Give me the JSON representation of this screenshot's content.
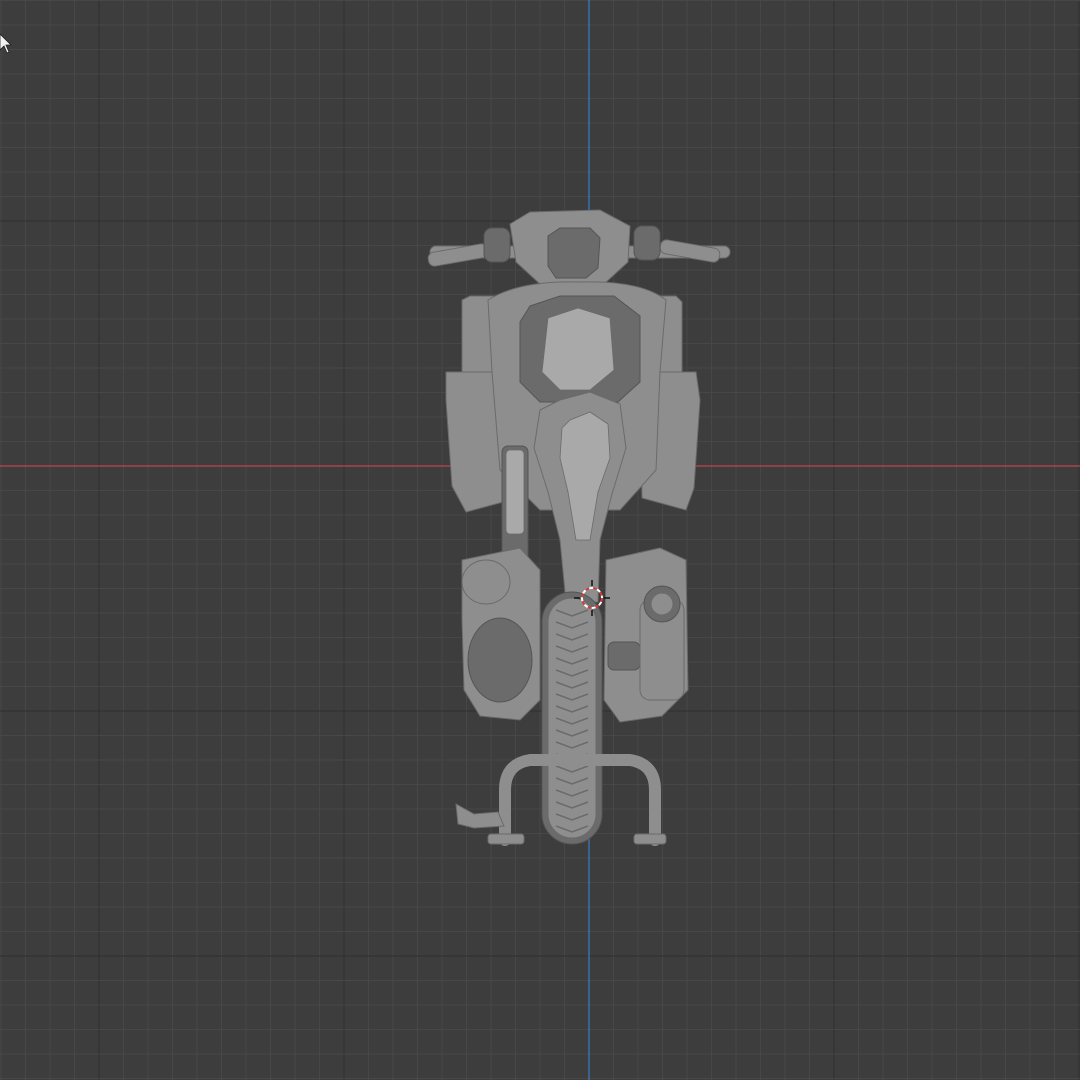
{
  "viewport": {
    "background_color": "#3d3d3d",
    "grid_minor_color": "#474747",
    "grid_major_color": "#2e2e2e",
    "x_axis_color": "#c2434f",
    "y_axis_color": "#3d7cc4",
    "view": "back-orthographic",
    "grid_visible": true
  },
  "model": {
    "name": "scooter",
    "base_color": "#8e8e8e",
    "shade_dark_color": "#6b6b6b",
    "shade_light_color": "#a9a9a9"
  },
  "cursor3d": {
    "icon": "3d-cursor-icon",
    "ring_color_a": "#d83a3a",
    "ring_color_b": "#ffffff"
  },
  "mouse_pointer": {
    "icon": "arrow-pointer-icon",
    "color": "#f2f2f2"
  }
}
